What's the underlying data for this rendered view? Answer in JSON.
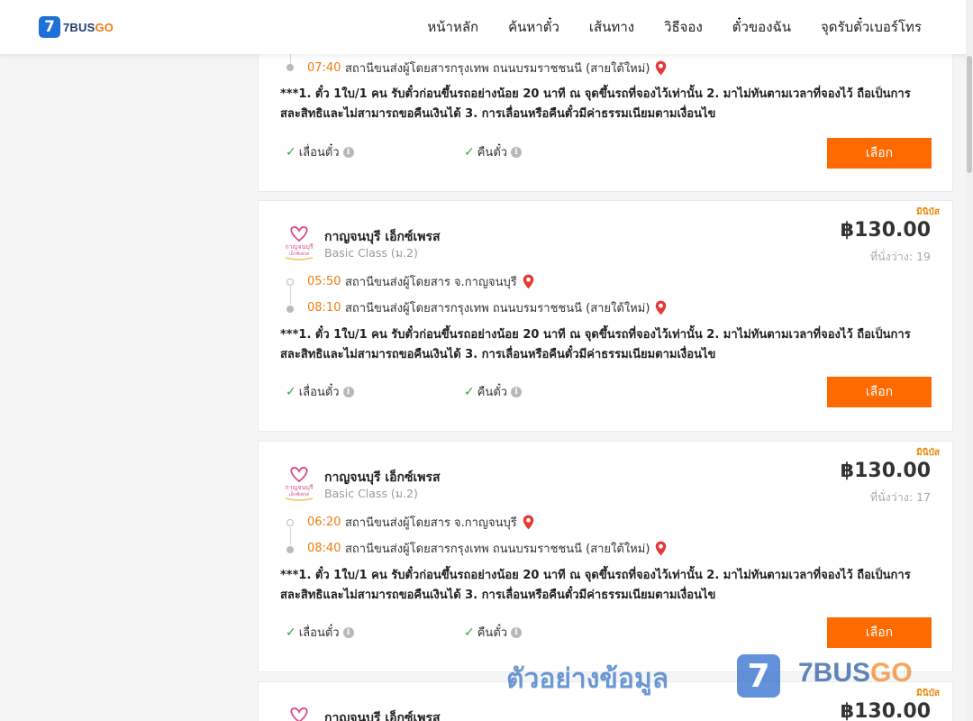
{
  "header": {
    "logo_num": "7",
    "logo_text_a": "7BUS",
    "logo_text_b": "GO",
    "nav": [
      "หน้าหลัก",
      "ค้นหาตั๋ว",
      "เส้นทาง",
      "วิธีจอง",
      "ตั๋วของฉัน",
      "จุดรับตั๋วเบอร์โทร"
    ]
  },
  "common": {
    "note": "***1. ตั๋ว 1ใบ/1 คน รับตั๋วก่อนขึ้นรถอย่างน้อย 20 นาที ณ จุดขึ้นรถที่จองไว้เท่านั้น 2. มาไม่ทันตามเวลาที่จองไว้ ถือเป็นการสละสิทธิและไม่สามารถขอคืนเงินได้ 3. การเลื่อนหรือคืนตั๋วมีค่าธรรมเนียมตามเงื่อนไข",
    "reschedule": "เลื่อนตั๋ว",
    "refund": "คืนตั๋ว",
    "select": "เลือก",
    "info_glyph": "i",
    "check_glyph": "✓",
    "logo_top": "กาญจนบุรี",
    "logo_bottom": "เอ็กซ์เพรส"
  },
  "trips": [
    {
      "arrive_time": "07:40",
      "arrive_station": "สถานีขนส่งผู้โดยสารกรุงเทพ ถนนบรมราชชนนี (สายใต้ใหม่)"
    },
    {
      "bus_type": "มินิบัส",
      "operator": "กาญจนบุรี เอ็กซ์เพรส",
      "class": "Basic Class (ม.2)",
      "price": "฿130.00",
      "seats": "ที่นั่งว่าง: 19",
      "depart_time": "05:50",
      "depart_station": "สถานีขนส่งผู้โดยสาร จ.กาญจนบุรี",
      "arrive_time": "08:10",
      "arrive_station": "สถานีขนส่งผู้โดยสารกรุงเทพ ถนนบรมราชชนนี (สายใต้ใหม่)"
    },
    {
      "bus_type": "มินิบัส",
      "operator": "กาญจนบุรี เอ็กซ์เพรส",
      "class": "Basic Class (ม.2)",
      "price": "฿130.00",
      "seats": "ที่นั่งว่าง: 17",
      "depart_time": "06:20",
      "depart_station": "สถานีขนส่งผู้โดยสาร จ.กาญจนบุรี",
      "arrive_time": "08:40",
      "arrive_station": "สถานีขนส่งผู้โดยสารกรุงเทพ ถนนบรมราชชนนี (สายใต้ใหม่)"
    },
    {
      "bus_type": "มินิบัส",
      "operator": "กาญจนบุรี เอ็กซ์เพรส",
      "price": "฿130.00"
    }
  ],
  "watermark": {
    "text": "ตัวอย่างข้อมูล",
    "badge": "7",
    "brand_a": "7BUS",
    "brand_b": "GO"
  },
  "colors": {
    "accent": "#ff6a00",
    "time": "#f07c10",
    "check": "#2aa84a",
    "pin": "#e53935"
  }
}
